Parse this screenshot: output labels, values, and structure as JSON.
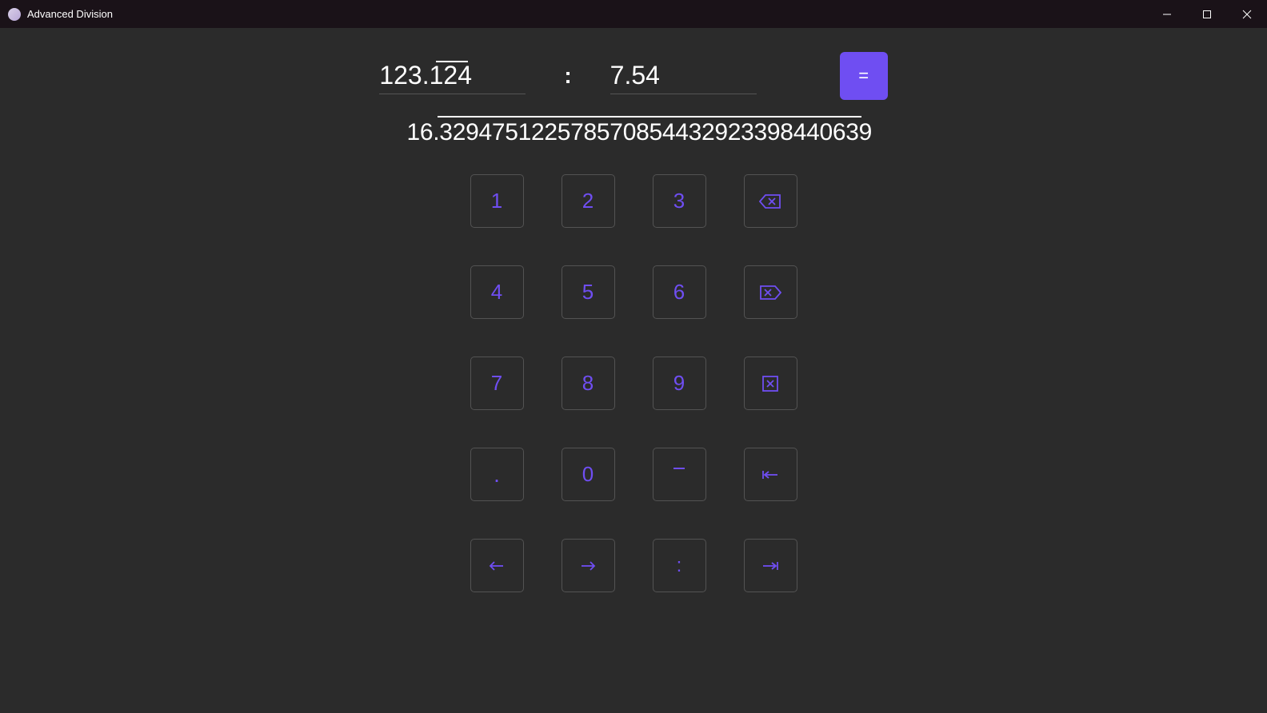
{
  "window": {
    "title": "Advanced Division"
  },
  "inputs": {
    "dividend": "123.124",
    "overbar_start_char": 4,
    "overbar_end_char": 7,
    "divisor": "7.54",
    "colon": ":"
  },
  "equals_label": "=",
  "result": "16.329475122578570854432923398440639",
  "keypad": {
    "k1": "1",
    "k2": "2",
    "k3": "3",
    "k4": "4",
    "k5": "5",
    "k6": "6",
    "k7": "7",
    "k8": "8",
    "k9": "9",
    "k0": "0",
    "period": ".",
    "colon": ":",
    "backspace_icon": "backspace",
    "delete_forward_icon": "delete-forward",
    "clear_icon": "clear",
    "repeating_overbar": "",
    "tab_left_icon": "tab-left",
    "arrow_left_icon": "arrow-left",
    "arrow_right_icon": "arrow-right",
    "tab_right_icon": "tab-right"
  }
}
